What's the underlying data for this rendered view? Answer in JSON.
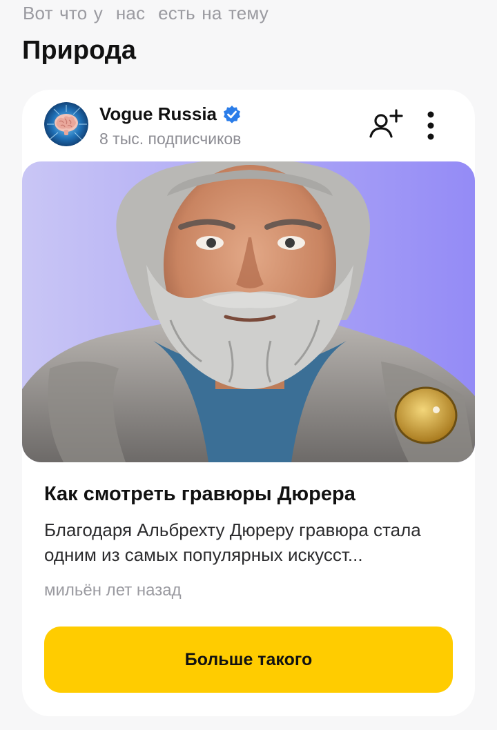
{
  "header": {
    "subtitle": "Вот что у  нас  есть на тему",
    "topic": "Природа"
  },
  "card": {
    "channel": {
      "name": "Vogue Russia",
      "subscribers": "8 тыс. подписчиков",
      "verified": true,
      "avatar_icon": "brain-avatar-icon",
      "verified_icon": "verified-badge-icon",
      "subscribe_icon": "person-plus-icon",
      "more_icon": "vertical-dots-icon"
    },
    "cover_image": "portrait of a bearded elderly man in grey robe",
    "article": {
      "title": "Как смотреть гравюры Дюрера",
      "snippet": "Благодаря Альбрехту Дюреру гравюра стала одним из самых популярных искусст...",
      "time": "мильён лет назад"
    },
    "more_like_label": "Больше такого"
  },
  "colors": {
    "background": "#f7f7f8",
    "card": "#ffffff",
    "accent_button": "#ffcc00",
    "verified_blue": "#2b7de9",
    "cover_background": "#a59cf7"
  }
}
